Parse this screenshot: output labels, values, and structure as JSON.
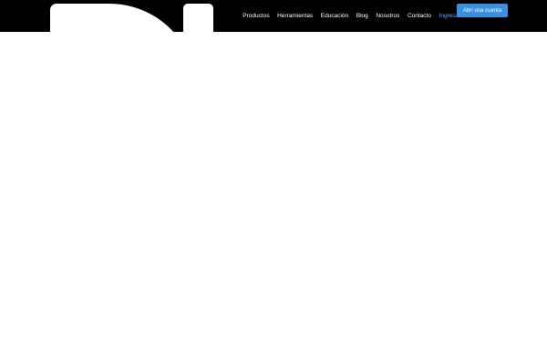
{
  "header": {
    "nav": [
      {
        "id": "productos",
        "label": "Productos"
      },
      {
        "id": "herramientas",
        "label": "Herramientas"
      },
      {
        "id": "educacion",
        "label": "Educación"
      },
      {
        "id": "blog",
        "label": "Blog"
      },
      {
        "id": "nosotros",
        "label": "Nosotros"
      },
      {
        "id": "contacto",
        "label": "Contacto"
      }
    ],
    "login_label": "Ingresar",
    "cta_label": "Abrí una cuenta"
  },
  "colors": {
    "header_bg": "#000000",
    "link_accent": "#5aa9ff",
    "cta_bg": "#3b8fe0"
  },
  "icons": {
    "logo": "brand-logo-icon"
  }
}
